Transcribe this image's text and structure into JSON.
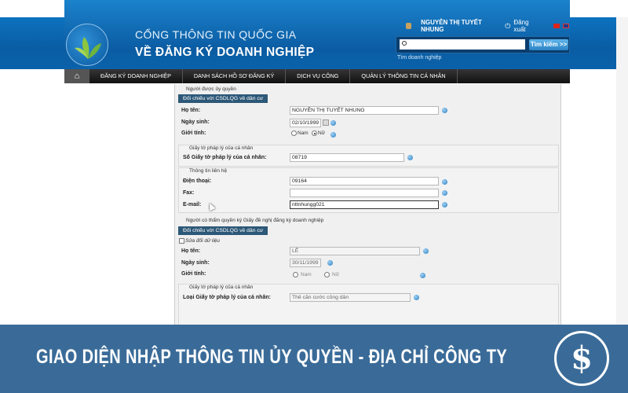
{
  "header": {
    "title_line1": "CỔNG THÔNG TIN QUỐC GIA",
    "title_line2": "VỀ ĐĂNG KÝ DOANH NGHIỆP",
    "user_name": "NGUYỄN THỊ TUYẾT NHUNG",
    "logout_label": "Đăng xuất",
    "search_placeholder": "",
    "search_button": "Tìm kiếm >>",
    "search_link": "Tìm doanh nghiệp"
  },
  "nav": {
    "items": [
      "ĐĂNG KÝ DOANH NGHIỆP",
      "DANH SÁCH HỒ SƠ ĐĂNG KÝ",
      "DỊCH VỤ CÔNG",
      "QUẢN LÝ THÔNG TIN CÁ NHÂN"
    ]
  },
  "form": {
    "auth_person": {
      "legend": "Người được ủy quyền",
      "badge": "Đối chiếu với CSDLQG về dân cư",
      "name_label": "Họ tên:",
      "name_value": "NGUYỄN THỊ TUYẾT NHUNG",
      "dob_label": "Ngày sinh:",
      "dob_value": "02/10/1999",
      "gender_label": "Giới tính:",
      "gender_male": "Nam",
      "gender_female": "Nữ",
      "legal_legend": "Giấy tờ pháp lý của cá nhân",
      "legal_label": "Số Giấy tờ pháp lý của cá nhân:",
      "legal_value": "08719",
      "contact_legend": "Thông tin liên hệ",
      "phone_label": "Điện thoại:",
      "phone_value": "09164",
      "fax_label": "Fax:",
      "fax_value": "",
      "email_label": "E-mail:",
      "email_value": "nttnhungg021"
    },
    "signer": {
      "legend": "Người có thẩm quyền ký Giấy đề nghị đăng ký doanh nghiệp",
      "badge": "Đối chiếu với CSDLQG về dân cư",
      "edit_label": "Sửa đổi dữ liệu",
      "name_label": "Họ tên:",
      "name_value": "LÊ",
      "dob_label": "Ngày sinh:",
      "dob_value": "30/11/1999",
      "gender_label": "Giới tính:",
      "gender_male": "Nam",
      "gender_female": "Nữ",
      "legal_legend": "Giấy tờ pháp lý của cá nhân",
      "legal_type_label": "Loại Giấy tờ pháp lý của cá nhân:",
      "legal_type_value": "Thẻ căn cước công dân"
    }
  },
  "footer": {
    "caption": "GIAO DIỆN NHẬP THÔNG TIN ỦY QUYỀN - ĐỊA CHỈ CÔNG TY",
    "logo_symbol": "$"
  },
  "colors": {
    "header_blue": "#0b62aa",
    "nav_dark": "#1a1a1a",
    "badge": "#2d5878",
    "footer_blue": "#3a6b98"
  }
}
